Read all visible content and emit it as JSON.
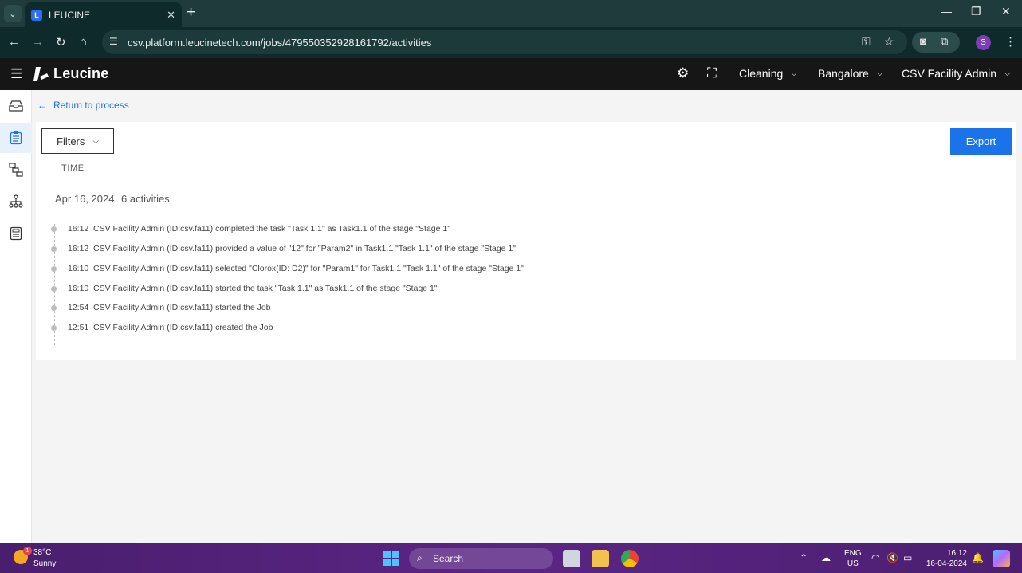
{
  "browser": {
    "tab_title": "LEUCINE",
    "tab_favicon": "L",
    "url": "csv.platform.leucinetech.com/jobs/479550352928161792/activities",
    "profile_initial": "S"
  },
  "header": {
    "brand": "Leucine",
    "use_case": "Cleaning",
    "facility": "Bangalore",
    "user": "CSV Facility Admin"
  },
  "page": {
    "return_label": "Return to process",
    "filters_label": "Filters",
    "export_label": "Export",
    "time_column": "TIME"
  },
  "activity_log": {
    "date": "Apr 16, 2024",
    "count_label": "6 activities",
    "items": [
      {
        "time": "16:12",
        "text": "CSV Facility Admin (ID:csv.fa11) completed the task \"Task 1.1\" as Task1.1 of the stage \"Stage 1\""
      },
      {
        "time": "16:12",
        "text": "CSV Facility Admin (ID:csv.fa11) provided a value of \"12\" for \"Param2\" in Task1.1 \"Task 1.1\" of the stage \"Stage 1\""
      },
      {
        "time": "16:10",
        "text": "CSV Facility Admin (ID:csv.fa11) selected \"Clorox(ID: D2)\" for \"Param1\" for Task1.1 \"Task 1.1\" of the stage \"Stage 1\""
      },
      {
        "time": "16:10",
        "text": "CSV Facility Admin (ID:csv.fa11) started the task \"Task 1.1\" as Task1.1 of the stage \"Stage 1\""
      },
      {
        "time": "12:54",
        "text": "CSV Facility Admin (ID:csv.fa11) started the Job"
      },
      {
        "time": "12:51",
        "text": "CSV Facility Admin (ID:csv.fa11) created the Job"
      }
    ]
  },
  "taskbar": {
    "weather_temp": "38°C",
    "weather_condition": "Sunny",
    "weather_badge": "1",
    "search_label": "Search",
    "lang_line1": "ENG",
    "lang_line2": "US",
    "time": "16:12",
    "date": "16-04-2024"
  },
  "colors": {
    "accent": "#1a73e8",
    "header_bg": "#161616",
    "browser_bg": "#0f2a2a"
  }
}
